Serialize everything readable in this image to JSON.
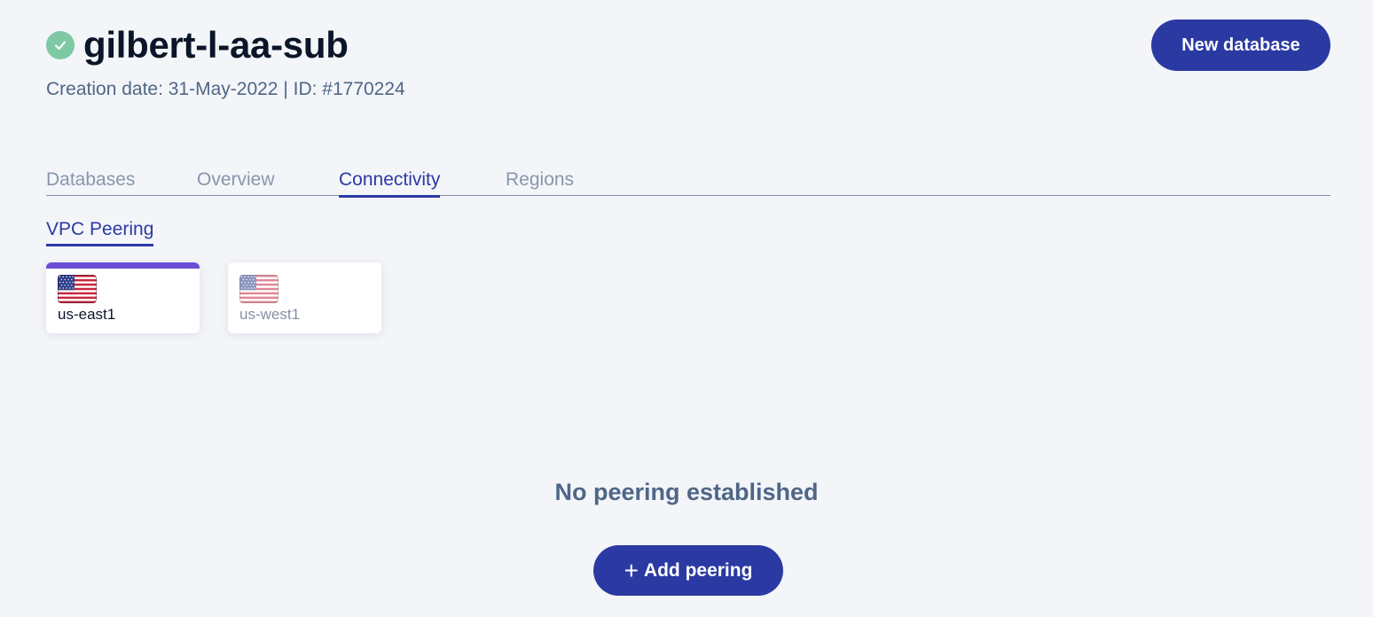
{
  "header": {
    "title": "gilbert-l-aa-sub",
    "status_icon": "check-circle-icon",
    "status_color": "#7ec8a4",
    "subtitle": "Creation date: 31-May-2022 | ID: #1770224",
    "new_database_label": "New database"
  },
  "tabs": [
    {
      "label": "Databases",
      "active": false
    },
    {
      "label": "Overview",
      "active": false
    },
    {
      "label": "Connectivity",
      "active": true
    },
    {
      "label": "Regions",
      "active": false
    }
  ],
  "subtab": {
    "label": "VPC Peering",
    "active": true
  },
  "regions": [
    {
      "label": "us-east1",
      "flag_icon": "us-flag-icon",
      "selected": true
    },
    {
      "label": "us-west1",
      "flag_icon": "us-flag-icon",
      "selected": false
    }
  ],
  "empty_state": {
    "message": "No peering established",
    "add_label": "Add peering",
    "add_icon": "plus-icon"
  },
  "colors": {
    "accent": "#2b3aa3",
    "selected_region_bar": "#6a4fd6",
    "background": "#f3f5f8"
  }
}
